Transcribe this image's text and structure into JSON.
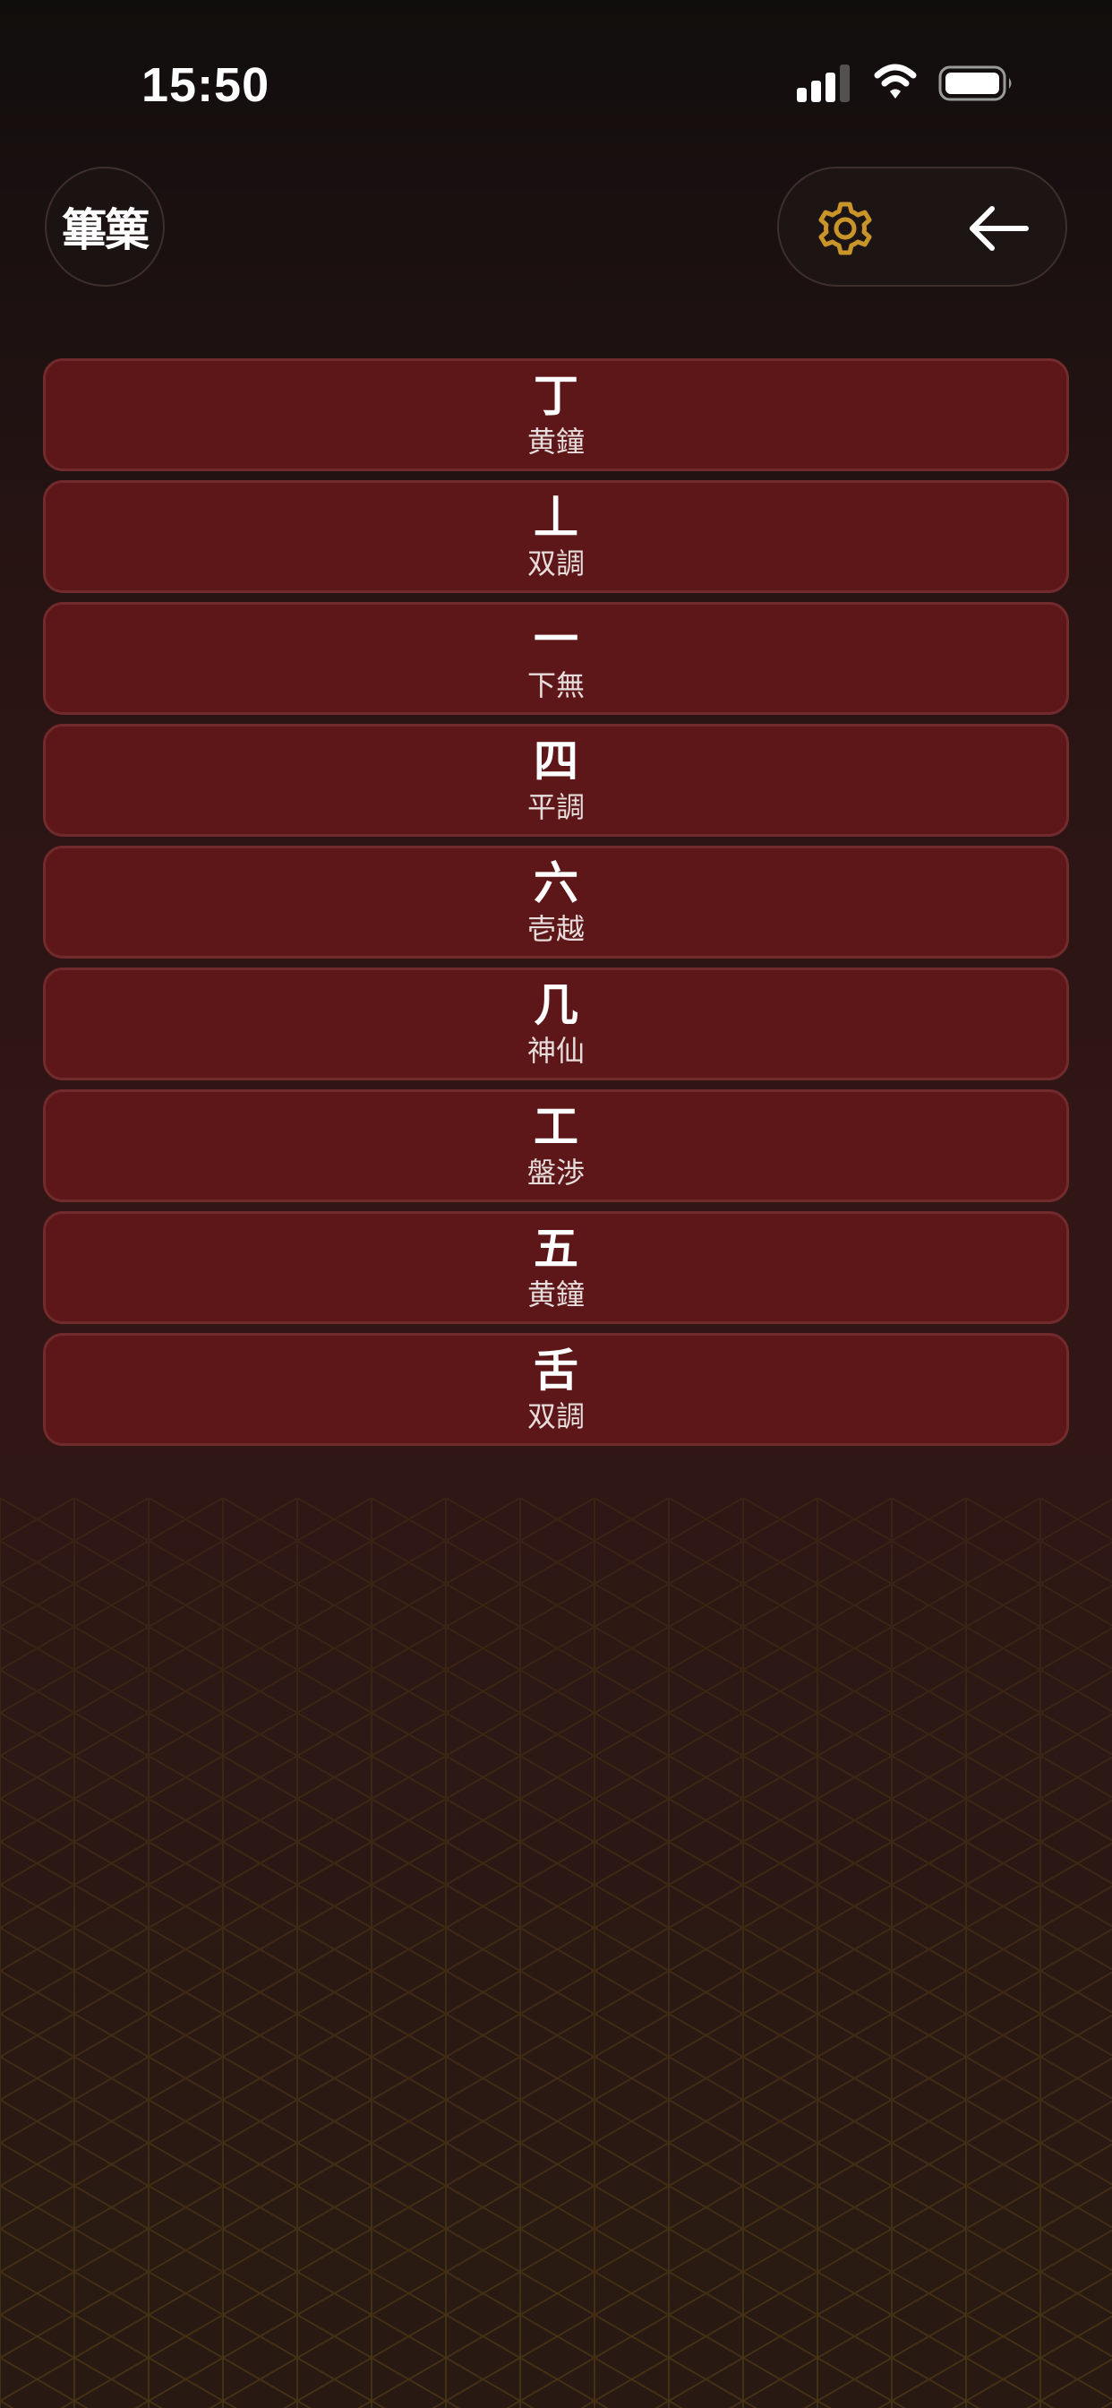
{
  "status_bar": {
    "time": "15:50"
  },
  "header": {
    "app_badge": "篳篥",
    "settings_icon": "gear-icon",
    "back_icon": "arrow-left-icon"
  },
  "notes": [
    {
      "glyph": "丁",
      "mode": "黄鐘"
    },
    {
      "glyph": "丄",
      "mode": "双調"
    },
    {
      "glyph": "一",
      "mode": "下無"
    },
    {
      "glyph": "四",
      "mode": "平調"
    },
    {
      "glyph": "六",
      "mode": "壱越"
    },
    {
      "glyph": "几",
      "mode": "神仙"
    },
    {
      "glyph": "工",
      "mode": "盤渉"
    },
    {
      "glyph": "五",
      "mode": "黄鐘"
    },
    {
      "glyph": "舌",
      "mode": "双調"
    }
  ],
  "colors": {
    "accent": "#c9952b",
    "row_background": "#5e1719",
    "row_border": "#722b2d",
    "pattern_line": "#4a3a1c"
  }
}
